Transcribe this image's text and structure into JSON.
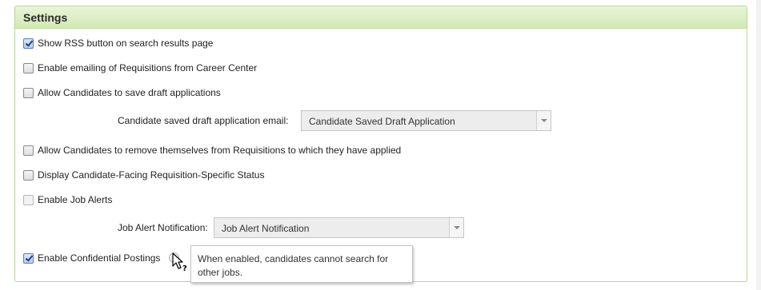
{
  "panel": {
    "title": "Settings"
  },
  "options": [
    {
      "label": "Show RSS button on search results page",
      "checked": true,
      "enabled": true
    },
    {
      "label": "Enable emailing of Requisitions from Career Center",
      "checked": false,
      "enabled": true
    },
    {
      "label": "Allow Candidates to save draft applications",
      "checked": false,
      "enabled": true
    },
    {
      "label": "Allow Candidates to remove themselves from Requisitions to which they have applied",
      "checked": false,
      "enabled": true
    },
    {
      "label": "Display Candidate-Facing Requisition-Specific Status",
      "checked": false,
      "enabled": true
    },
    {
      "label": "Enable Job Alerts",
      "checked": false,
      "enabled": false
    },
    {
      "label": "Enable Confidential Postings",
      "checked": true,
      "enabled": true
    }
  ],
  "draft_email": {
    "label": "Candidate saved draft application email:",
    "selected": "Candidate Saved Draft Application"
  },
  "job_alert": {
    "label": "Job Alert Notification:",
    "selected": "Job Alert Notification"
  },
  "tooltip": {
    "text": "When enabled, candidates cannot search for other jobs."
  },
  "icons": {
    "help": "help-icon",
    "cursor": "help-cursor-icon"
  }
}
